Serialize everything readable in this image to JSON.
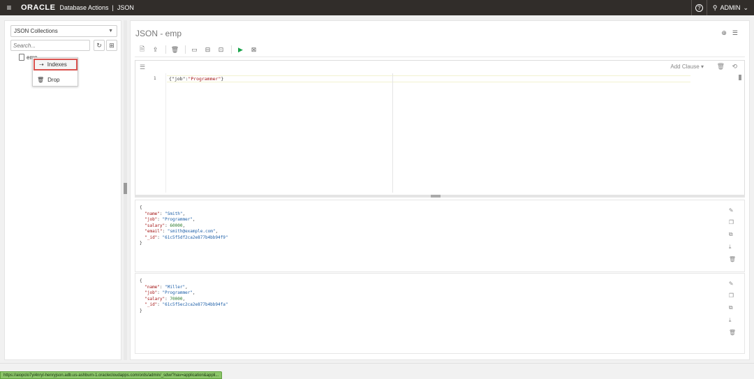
{
  "header": {
    "brand": "ORACLE",
    "app_name": "Database Actions",
    "separator": "|",
    "page": "JSON",
    "user": "ADMIN"
  },
  "sidebar": {
    "collection_select": "JSON Collections",
    "search_placeholder": "Search...",
    "tree": [
      {
        "label": "emp"
      }
    ],
    "context_menu": [
      {
        "label": "Indexes",
        "icon": "indexes-icon",
        "highlighted": true
      },
      {
        "label": "Drop",
        "icon": "trash-icon"
      }
    ]
  },
  "main": {
    "title": "JSON - emp",
    "editor": {
      "add_clause": "Add Clause",
      "line_number": "1",
      "query_prefix": "{\"job\":",
      "query_value": "\"Programmer\"",
      "query_suffix": "}"
    },
    "documents": [
      {
        "name": "Smith",
        "job": "Programmer",
        "salary": "60000",
        "email": "smith@example.com",
        "id": "61c5f5df2ca2e877b4bb94f9"
      },
      {
        "name": "Miller",
        "job": "Programmer",
        "salary": "70000",
        "id": "61c5f5ec2ca2e877b4bb94fa"
      }
    ]
  },
  "status_url": "https://aiopclo7yi4nryl-henryjson.adb.us-ashburn-1.oraclecloudapps.com/ords/admin/_sdw/?nav=application&appli..."
}
